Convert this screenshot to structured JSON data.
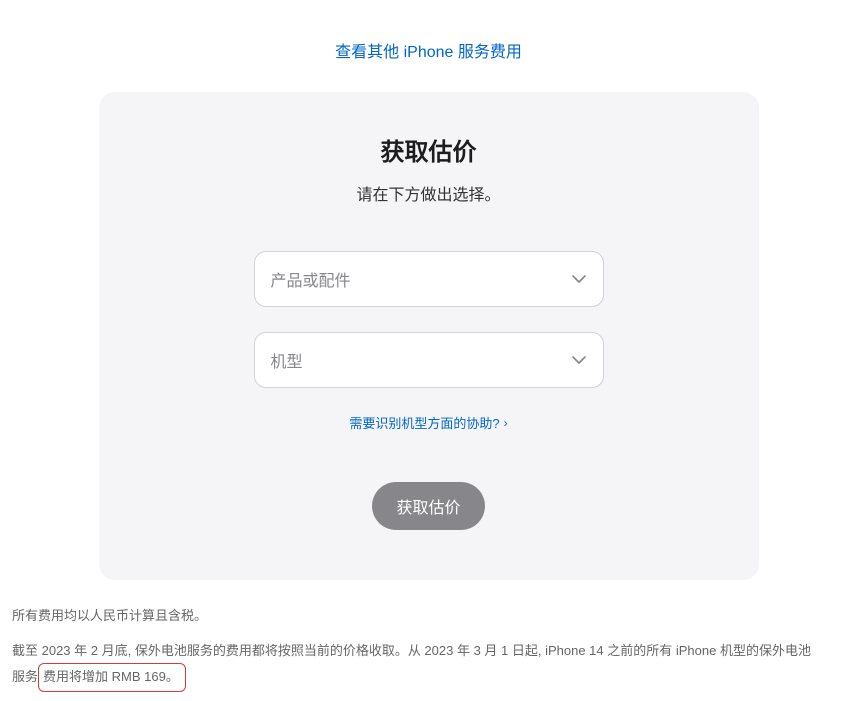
{
  "topLink": "查看其他 iPhone 服务费用",
  "card": {
    "title": "获取估价",
    "subtitle": "请在下方做出选择。",
    "select1": "产品或配件",
    "select2": "机型",
    "helpLink": "需要识别机型方面的协助?",
    "button": "获取估价"
  },
  "footnote": {
    "line1": "所有费用均以人民币计算且含税。",
    "line2a": "截至 2023 年 2 月底, 保外电池服务的费用都将按照当前的价格收取。从 2023 年 3 月 1 日起, iPhone 14 之前的所有 iPhone 机型的保外电池服务",
    "line2b": "费用将增加 RMB 169。"
  }
}
